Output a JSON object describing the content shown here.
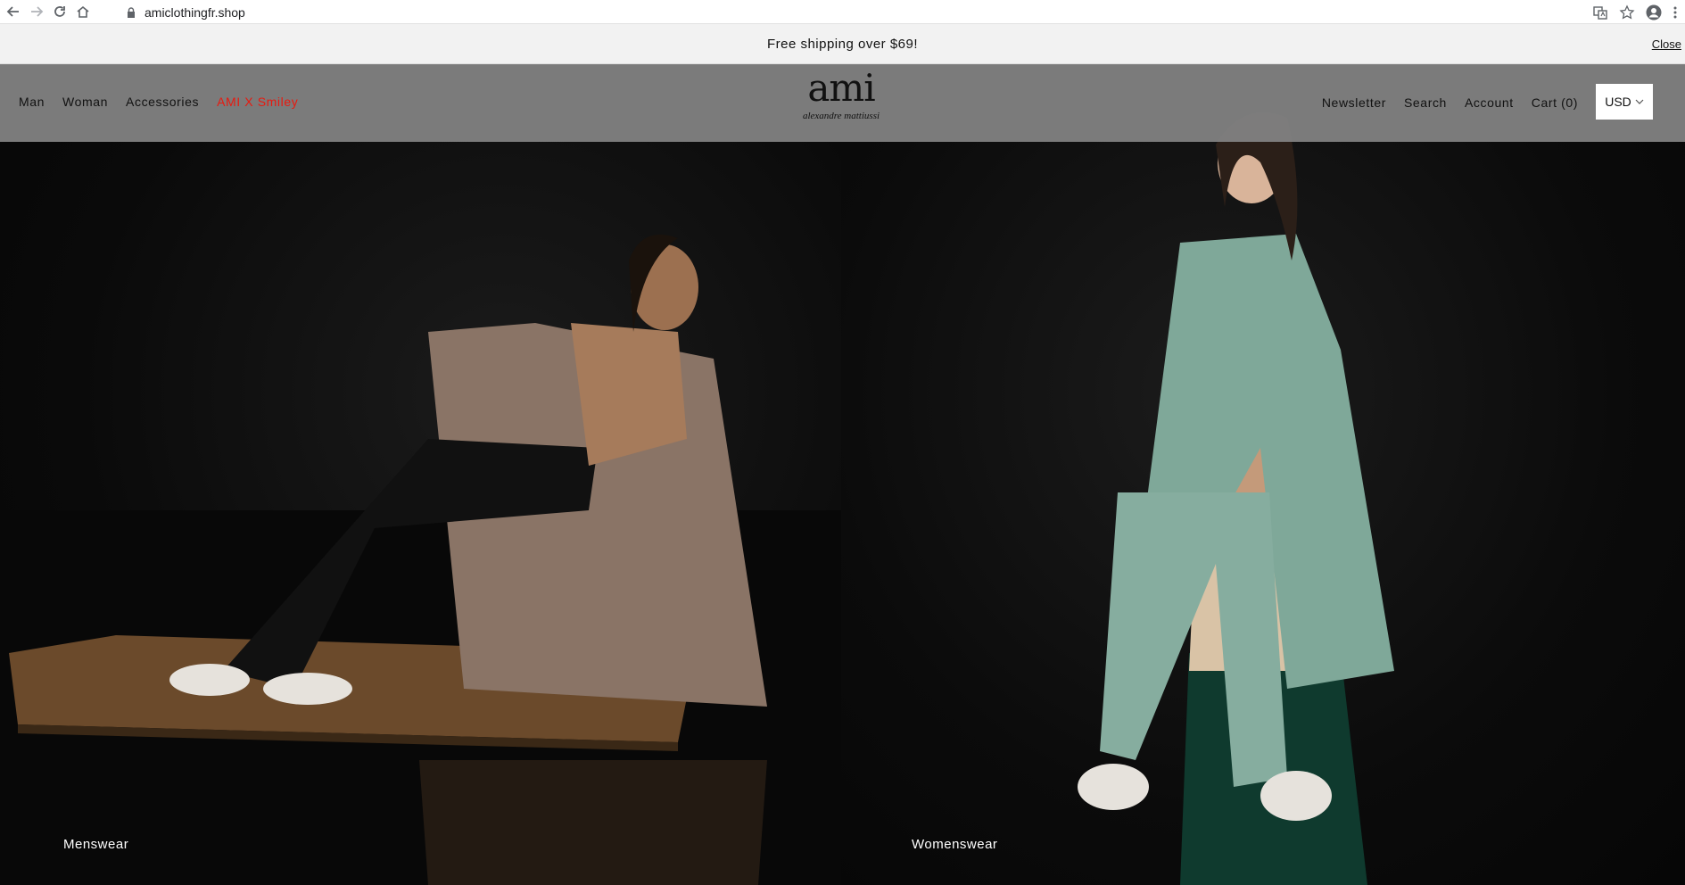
{
  "browser": {
    "url": "amiclothingfr.shop"
  },
  "announcement": {
    "text": "Free shipping over $69!",
    "close_label": "Close"
  },
  "header": {
    "nav_left": [
      {
        "label": "Man"
      },
      {
        "label": "Woman"
      },
      {
        "label": "Accessories"
      },
      {
        "label": "AMI X Smiley",
        "accent_color": "#e8190f"
      }
    ],
    "logo": {
      "main": "ami",
      "sub": "alexandre mattiussi"
    },
    "nav_right": [
      {
        "label": "Newsletter"
      },
      {
        "label": "Search"
      },
      {
        "label": "Account"
      },
      {
        "label": "Cart (0)"
      }
    ],
    "currency": "USD"
  },
  "hero": {
    "left_caption": "Menswear",
    "right_caption": "Womenswear"
  }
}
